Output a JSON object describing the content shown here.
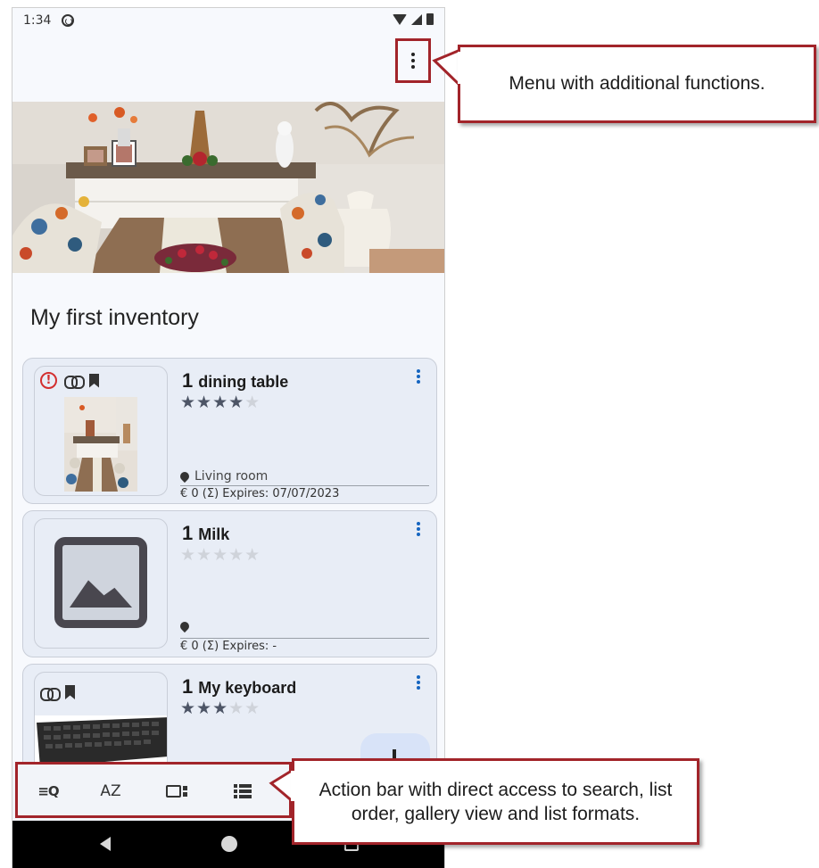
{
  "status_bar": {
    "time": "1:34"
  },
  "inventory": {
    "title": "My first inventory",
    "items": [
      {
        "qty": "1",
        "name": "dining table",
        "rating": 4,
        "location": "Living room",
        "footer": "€ 0  (Σ)  Expires: 07/07/2023",
        "flags": [
          "alert-icon",
          "link-icon",
          "bookmark-icon"
        ]
      },
      {
        "qty": "1",
        "name": "Milk",
        "rating": 0,
        "location": "",
        "footer": "€ 0  (Σ)  Expires: -",
        "flags": []
      },
      {
        "qty": "1",
        "name": "My keyboard",
        "rating": 3,
        "location": "",
        "footer": "",
        "flags": [
          "link-icon",
          "bookmark-icon"
        ]
      }
    ]
  },
  "action_bar": {
    "buttons": [
      {
        "name": "search-button",
        "glyph": "≡Q"
      },
      {
        "name": "sort-button",
        "glyph": "AZ"
      },
      {
        "name": "gallery-view-button",
        "icon": "gallery-icon"
      },
      {
        "name": "list-format-button",
        "icon": "list-format-icon"
      }
    ]
  },
  "annotations": {
    "menu": "Menu with additional functions.",
    "action_bar": "Action bar with direct access to search, list order, gallery view and list formats."
  },
  "colors": {
    "annotation_border": "#a2242a",
    "card_background": "#e8edf6",
    "alert": "#d32f2f",
    "menu_dots": "#1565c0"
  }
}
